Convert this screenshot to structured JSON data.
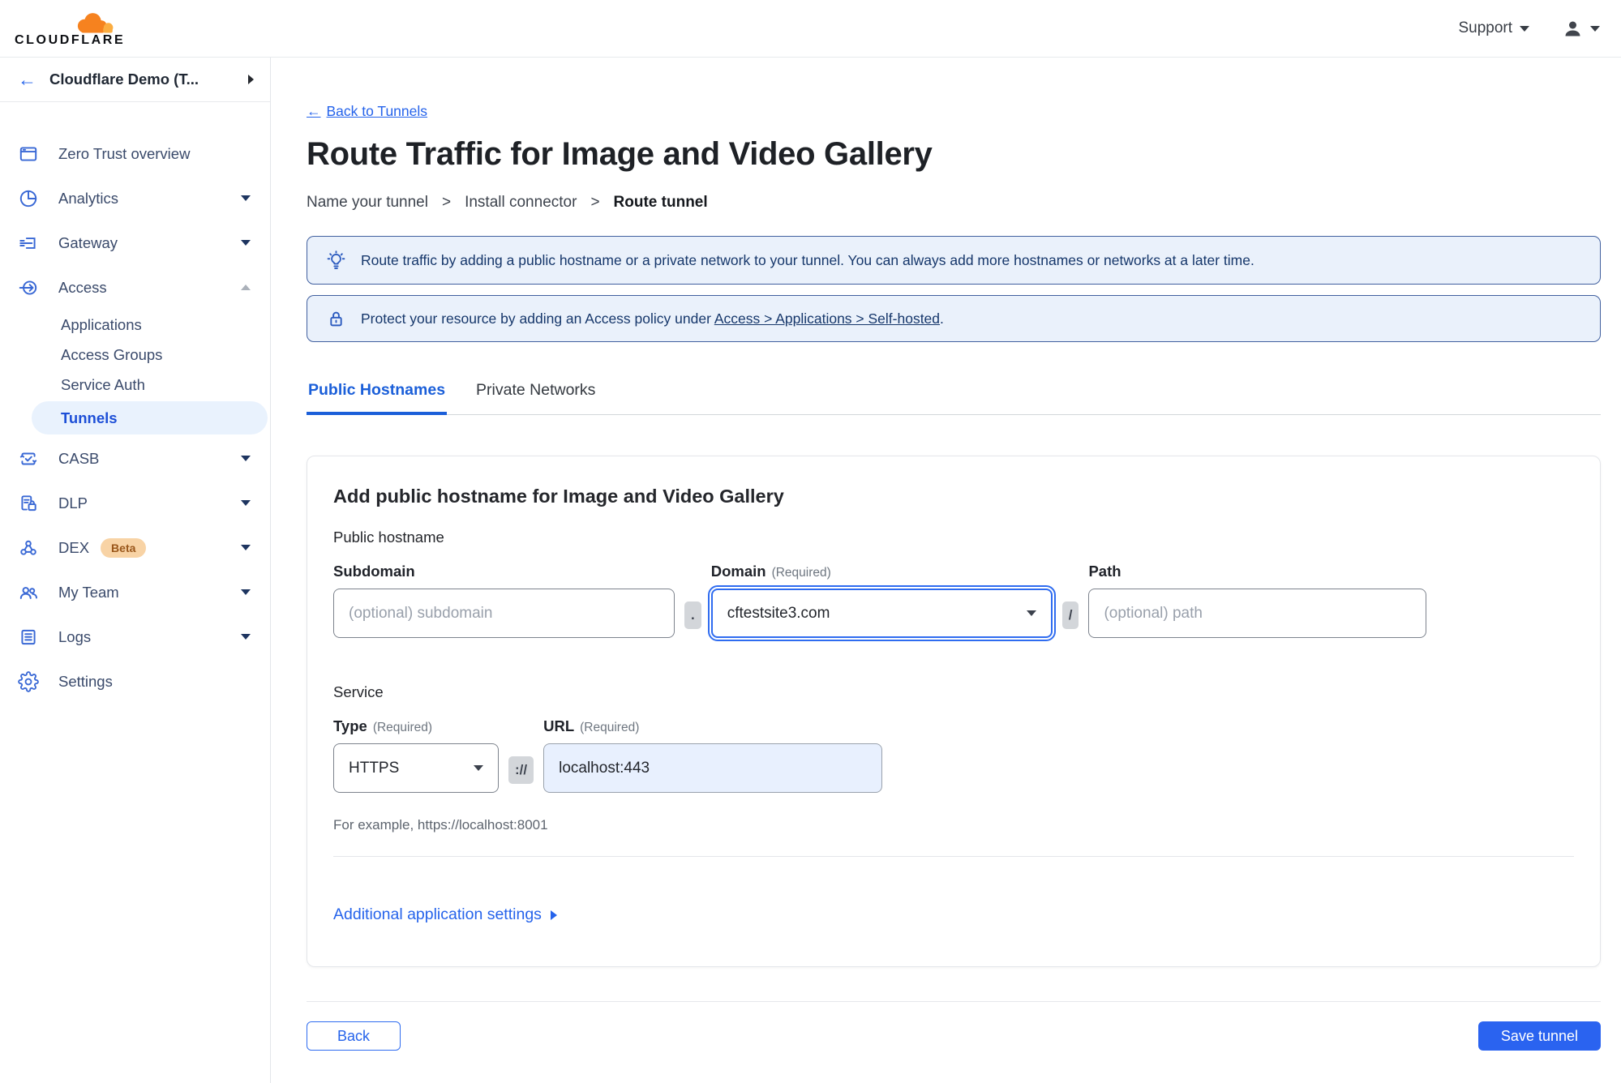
{
  "topbar": {
    "brand": "CLOUDFLARE",
    "support": "Support"
  },
  "sidebar": {
    "back_arrow": "←",
    "account": "Cloudflare Demo (T...",
    "items": [
      {
        "label": "Zero Trust overview"
      },
      {
        "label": "Analytics"
      },
      {
        "label": "Gateway"
      },
      {
        "label": "Access"
      },
      {
        "label": "CASB"
      },
      {
        "label": "DLP"
      },
      {
        "label": "DEX",
        "badge": "Beta"
      },
      {
        "label": "My Team"
      },
      {
        "label": "Logs"
      },
      {
        "label": "Settings"
      }
    ],
    "access_children": [
      {
        "label": "Applications"
      },
      {
        "label": "Access Groups"
      },
      {
        "label": "Service Auth"
      },
      {
        "label": "Tunnels",
        "active": true
      }
    ]
  },
  "main": {
    "back_link": {
      "arrow": "←",
      "label": "Back to Tunnels"
    },
    "title": "Route Traffic for Image and Video Gallery",
    "steps": {
      "s1": "Name your tunnel",
      "sep": ">",
      "s2": "Install connector",
      "s3": "Route tunnel"
    },
    "banners": {
      "info": "Route traffic by adding a public hostname or a private network to your tunnel. You can always add more hostnames or networks at a later time.",
      "protect_prefix": "Protect your resource by adding an Access policy under",
      "protect_link": "Access > Applications > Self-hosted",
      "protect_suffix": "."
    },
    "tabs": {
      "t1": "Public Hostnames",
      "t2": "Private Networks"
    },
    "card": {
      "heading": "Add public hostname for Image and Video Gallery",
      "group1": "Public hostname",
      "subdomain_label": "Subdomain",
      "subdomain_placeholder": "(optional) subdomain",
      "dot": ".",
      "domain_label": "Domain",
      "required": "(Required)",
      "domain_value": "cftestsite3.com",
      "slash": "/",
      "path_label": "Path",
      "path_placeholder": "(optional) path",
      "group2": "Service",
      "type_label": "Type",
      "type_value": "HTTPS",
      "scheme": "://",
      "url_label": "URL",
      "url_value": "localhost:443",
      "example": "For example, https://localhost:8001",
      "additional": "Additional application settings"
    },
    "footer": {
      "back": "Back",
      "save": "Save tunnel"
    }
  },
  "colors": {
    "accent": "#2563eb",
    "save_button": "#2a63f0",
    "banner_bg": "#eaf1fb",
    "banner_border": "#41609f",
    "banner_text": "#16376b",
    "sidebar_icon": "#3968d5",
    "sidebar_text": "#3a4a6b",
    "active_pill_bg": "#e9f2fd",
    "active_pill_text": "#1d4fd7",
    "beta_bg": "#f8d3a5",
    "beta_text": "#9a571b",
    "url_input_bg": "#e8f0fe",
    "logo_orange_dark": "#f6821f",
    "logo_orange_light": "#fbad41"
  }
}
